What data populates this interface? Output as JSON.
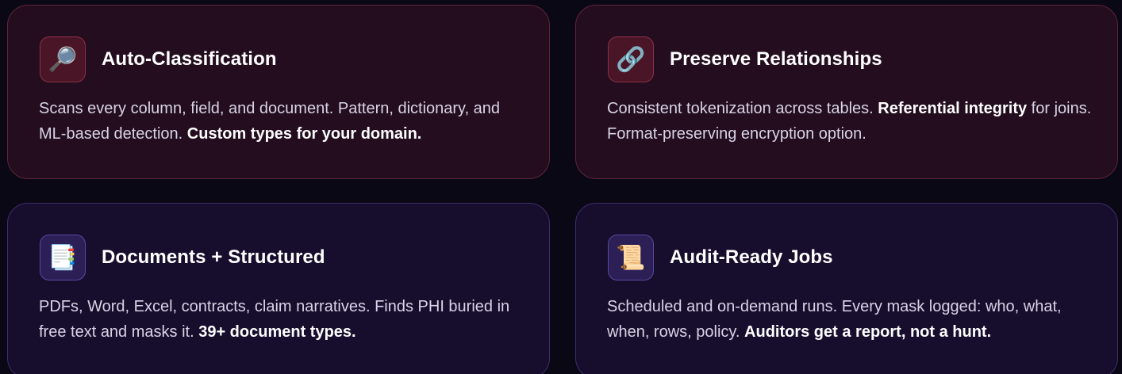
{
  "features": [
    {
      "icon": "magnifying-glass-icon",
      "icon_glyph": "🔎",
      "title": "Auto-Classification",
      "text": "Scans every column, field, and document. Pattern, dictionary, and ML-based detection. ",
      "text_after": "",
      "bold": "Custom types for your domain."
    },
    {
      "icon": "link-icon",
      "icon_glyph": "🔗",
      "title": "Preserve Relationships",
      "text": "Consistent tokenization across tables. ",
      "bold": "Referential integrity",
      "text_after": " for joins. Format-preserving encryption option."
    },
    {
      "icon": "document-tabs-icon",
      "icon_glyph": "📑",
      "title": "Documents + Structured",
      "text": "PDFs, Word, Excel, contracts, claim narratives. Finds PHI buried in free text and masks it. ",
      "bold": "39+ document types.",
      "text_after": ""
    },
    {
      "icon": "scroll-icon",
      "icon_glyph": "📜",
      "title": "Audit-Ready Jobs",
      "text": "Scheduled and on-demand runs. Every mask logged: who, what, when, rows, policy. ",
      "bold": "Auditors get a report, not a hunt.",
      "text_after": ""
    }
  ],
  "colors": {
    "page_background": "#0a0815",
    "card_red_background": "#230d1f",
    "card_purple_background": "#170e2e",
    "title": "#ffffff",
    "body_text": "#d8d4e6"
  }
}
